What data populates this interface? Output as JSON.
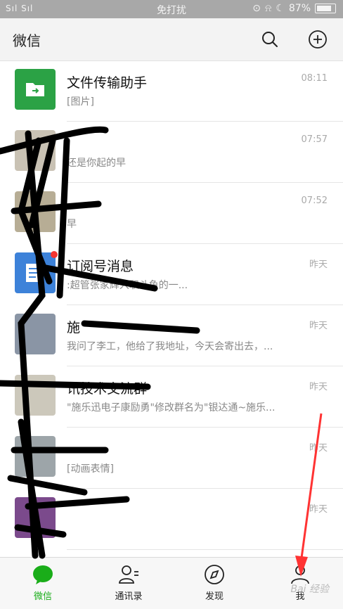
{
  "status": {
    "signal": "Sıl Sıl",
    "dnd": "免打扰",
    "battery": "87%"
  },
  "header": {
    "title": "微信"
  },
  "chats": [
    {
      "name": "文件传输助手",
      "preview": "[图片]",
      "time": "08:11"
    },
    {
      "name": "",
      "preview": "还是你起的早",
      "time": "07:57"
    },
    {
      "name": "",
      "preview": "早",
      "time": "07:52"
    },
    {
      "name": "订阅号消息",
      "preview": ":超管张家辉入职斗鱼的一...",
      "time": "昨天"
    },
    {
      "name": "施",
      "preview": "我问了李工，他给了我地址，今天会寄出去，...",
      "time": "昨天"
    },
    {
      "name": "讯技术交流群",
      "preview": "\"施乐迅电子康励勇\"修改群名为\"银达通~施乐...",
      "time": "昨天"
    },
    {
      "name": "",
      "preview": "[动画表情]",
      "time": "昨天"
    },
    {
      "name": "",
      "preview": "",
      "time": "昨天"
    }
  ],
  "tabs": [
    {
      "label": "微信"
    },
    {
      "label": "通讯录"
    },
    {
      "label": "发现"
    },
    {
      "label": "我"
    }
  ],
  "watermark": "Bai 经验",
  "colors": {
    "brand_green": "#1aad19",
    "badge_red": "#f43530"
  }
}
